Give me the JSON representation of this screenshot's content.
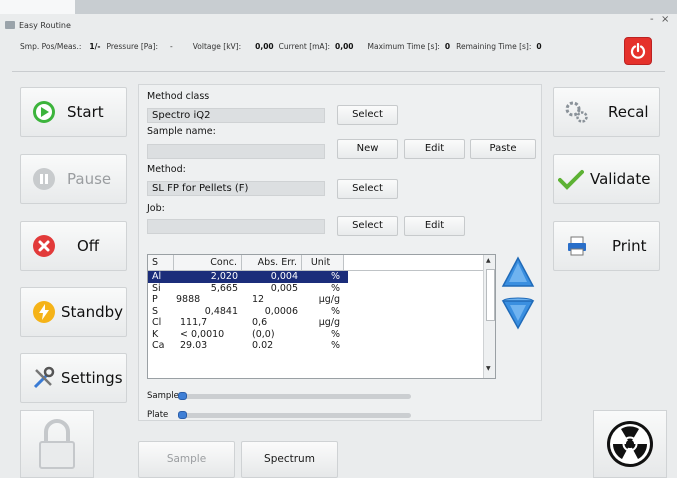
{
  "window": {
    "title": "Easy Routine",
    "minimize_glyph": "-",
    "close_glyph": "×"
  },
  "status": {
    "smp_label": "Smp. Pos/Meas.:",
    "smp_value": "1/-",
    "pressure_label": "Pressure [Pa]:",
    "pressure_value": "-",
    "voltage_label": "Voltage [kV]:",
    "voltage_value": "0,00",
    "current_label": "Current [mA]:",
    "current_value": "0,00",
    "maxtime_label": "Maximum Time [s]:",
    "maxtime_value": "0",
    "remtime_label": "Remaining Time [s]:",
    "remtime_value": "0"
  },
  "left_buttons": {
    "start": "Start",
    "pause": "Pause",
    "off": "Off",
    "standby": "Standby",
    "settings": "Settings"
  },
  "right_buttons": {
    "recal": "Recal",
    "validate": "Validate",
    "print": "Print"
  },
  "form": {
    "method_class_label": "Method class",
    "method_class_value": "Spectro iQ2",
    "sample_name_label": "Sample name:",
    "sample_name_value": "",
    "method_label": "Method:",
    "method_value": "SL FP for Pellets (F)",
    "job_label": "Job:",
    "job_value": "",
    "select_label": "Select",
    "new_label": "New",
    "edit_label": "Edit",
    "paste_label": "Paste"
  },
  "table": {
    "headers": [
      "S",
      "Conc.",
      "Abs. Err.",
      "Unit"
    ],
    "rows": [
      {
        "s": "Al",
        "conc": "2,020",
        "err": "0,004",
        "unit": "%"
      },
      {
        "s": "Si",
        "conc": "5,665",
        "err": "0,005",
        "unit": "%"
      },
      {
        "s": "P",
        "conc": "9888",
        "err": "12",
        "unit": "µg/g"
      },
      {
        "s": "S",
        "conc": "0,4841",
        "err": "0,0006",
        "unit": "%"
      },
      {
        "s": "Cl",
        "conc": "111,7",
        "err": "0,6",
        "unit": "µg/g"
      },
      {
        "s": "K",
        "conc": "< 0,0010",
        "err": "(0,0)",
        "unit": "%"
      },
      {
        "s": "Ca",
        "conc": "29.03",
        "err": "0.02",
        "unit": "%"
      }
    ]
  },
  "progress": {
    "sample_label": "Sample",
    "plate_label": "Plate",
    "sample_value": 0,
    "plate_value": 0
  },
  "tabs": {
    "sample": "Sample",
    "spectrum": "Spectrum"
  },
  "colors": {
    "power": "#e5312b",
    "selected_row": "#1b2d7a",
    "arrow": "#3a8fe0"
  }
}
